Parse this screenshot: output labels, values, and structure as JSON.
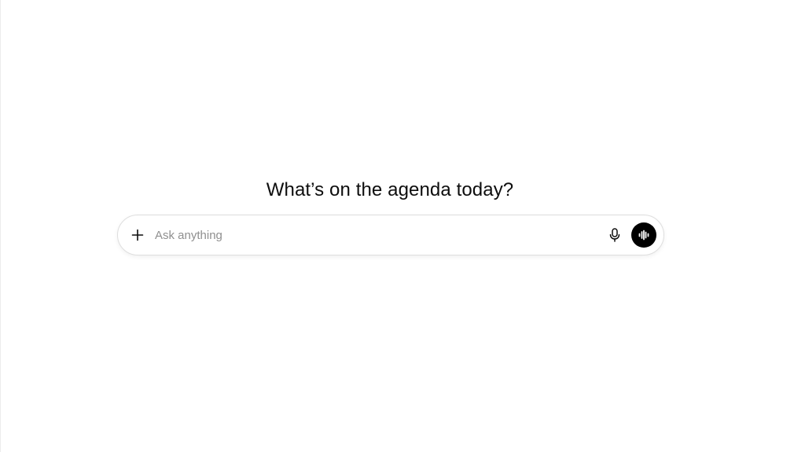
{
  "main": {
    "heading": "What’s on the agenda today?"
  },
  "composer": {
    "placeholder": "Ask anything",
    "value": "",
    "icons": {
      "add": "plus-icon",
      "dictate": "microphone-icon",
      "voice": "voice-waveform-icon"
    },
    "colors": {
      "voice_button_bg": "#000000",
      "placeholder": "#8f8f8f",
      "border": "#dedede"
    }
  }
}
